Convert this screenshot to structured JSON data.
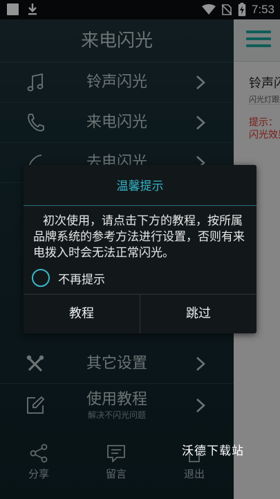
{
  "status_bar": {
    "time": "7:53"
  },
  "drawer": {
    "title": "来电闪光",
    "items": [
      {
        "label": "铃声闪光",
        "icon": "music-note-icon"
      },
      {
        "label": "来电闪光",
        "icon": "phone-icon"
      },
      {
        "label": "去电闪光",
        "icon": "phone-outgoing-icon"
      },
      {
        "label": "其它设置",
        "icon": "tools-icon"
      },
      {
        "label": "使用教程",
        "sublabel": "解决不闪光问题",
        "icon": "edit-icon"
      }
    ],
    "bottom": [
      {
        "label": "分享",
        "icon": "share-icon"
      },
      {
        "label": "留言",
        "icon": "message-icon"
      },
      {
        "label": "退出",
        "icon": "exit-icon"
      }
    ]
  },
  "right_panel": {
    "title": "铃声闪光",
    "subtitle": "闪光灯跟随铃声",
    "tip_line1": "提示：",
    "tip_line2": "闪光效果"
  },
  "dialog": {
    "title": "温馨提示",
    "message": "初次使用，请点击下方的教程，按所属品牌系统的参考方法进行设置，否则有来电拨入时会无法正常闪光。",
    "checkbox_label": "不再提示",
    "checkbox_checked": false,
    "button_left": "教程",
    "button_right": "跳过"
  },
  "watermark": "沃德下载站",
  "colors": {
    "accent": "#33b5c8",
    "warning": "#d0302a",
    "menu_teal": "#1aa39a"
  }
}
